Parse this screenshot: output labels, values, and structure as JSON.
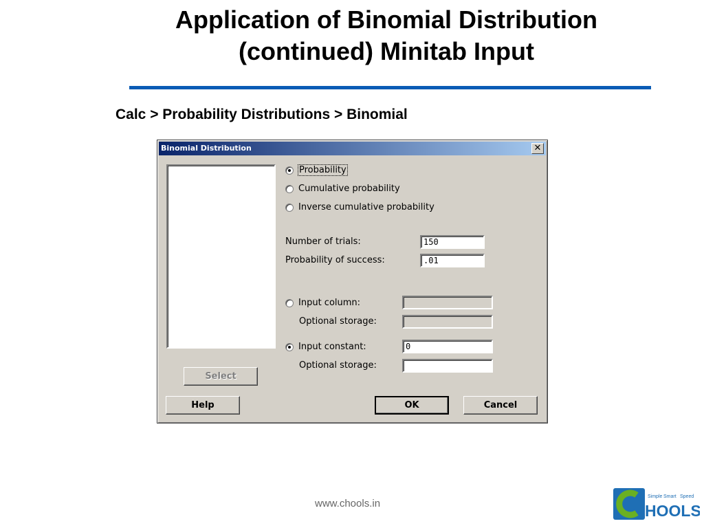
{
  "slide": {
    "title_line1": "Application of Binomial Distribution",
    "title_line2": "(continued) Minitab Input",
    "breadcrumb": "Calc > Probability Distributions > Binomial",
    "footer_url": "www.chools.in"
  },
  "dialog": {
    "title": "Binomial Distribution",
    "close_symbol": "✕",
    "radios": [
      {
        "label": "Probability",
        "checked": true
      },
      {
        "label": "Cumulative probability",
        "checked": false
      },
      {
        "label": "Inverse cumulative probability",
        "checked": false
      }
    ],
    "fields": {
      "trials_label": "Number of trials:",
      "trials_value": "150",
      "prob_label": "Probability of success:",
      "prob_value": ".01"
    },
    "input_column": {
      "label": "Input column:",
      "checked": false,
      "storage_label": "Optional storage:"
    },
    "input_constant": {
      "label": "Input constant:",
      "checked": true,
      "value": "0",
      "storage_label": "Optional storage:"
    },
    "buttons": {
      "select": "Select",
      "help": "Help",
      "ok": "OK",
      "cancel": "Cancel"
    }
  },
  "logo": {
    "tagline_1": "Simple",
    "tagline_2": "Smart",
    "tagline_3": "Speed",
    "text": "HOOLS"
  },
  "colors": {
    "accent_rule": "#0a5bb5",
    "titlebar_start": "#0a246a",
    "dialog_bg": "#d4d0c8",
    "logo_green": "#6ab023",
    "logo_blue": "#1f6fb5"
  }
}
